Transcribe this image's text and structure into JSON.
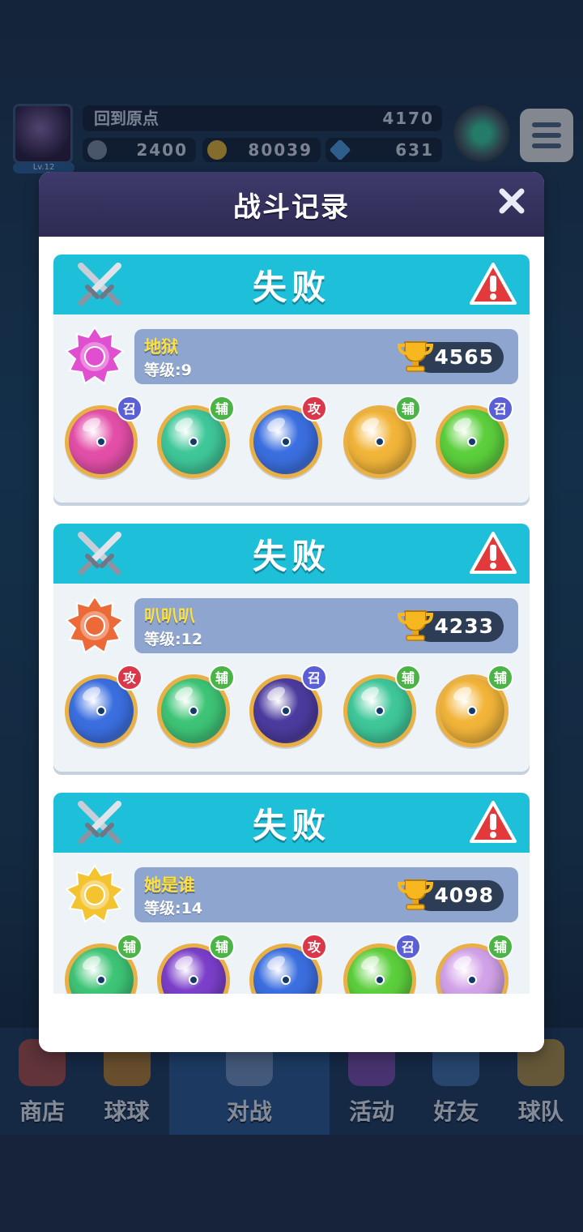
{
  "topbar": {
    "player_name": "回到原点",
    "trophies": "4170",
    "currency_a": "2400",
    "gold": "80039",
    "gems": "631",
    "level": "Lv.12"
  },
  "bottom_nav": [
    {
      "label": "商店",
      "icon": "shop-icon"
    },
    {
      "label": "球球",
      "icon": "ball-icon"
    },
    {
      "label": "对战",
      "icon": "battle-icon",
      "active": true
    },
    {
      "label": "活动",
      "icon": "event-icon"
    },
    {
      "label": "好友",
      "icon": "friends-icon"
    },
    {
      "label": "球队",
      "icon": "team-icon"
    }
  ],
  "modal": {
    "title": "战斗记录",
    "close_icon": "close-icon"
  },
  "records": [
    {
      "result": "失败",
      "opponent": "地狱",
      "level": "等级:9",
      "trophies": "4565",
      "medal_color": "#e04fd0",
      "balls": [
        {
          "role": "召",
          "color": "#e34fa8",
          "icon": "blade-ball-icon"
        },
        {
          "role": "辅",
          "color": "#3fc79a",
          "icon": "sp-ball-icon"
        },
        {
          "role": "攻",
          "color": "#3b6fe0",
          "icon": "vortex-ball-icon"
        },
        {
          "role": "辅",
          "color": "#f2b53a",
          "icon": "skull-ball-icon"
        },
        {
          "role": "召",
          "color": "#5ccf3d",
          "icon": "star-ball-icon"
        }
      ]
    },
    {
      "result": "失败",
      "opponent": "叭叭叭",
      "level": "等级:12",
      "trophies": "4233",
      "medal_color": "#ec6a37",
      "balls": [
        {
          "role": "攻",
          "color": "#3b6fe0",
          "icon": "vortex-ball-icon"
        },
        {
          "role": "辅",
          "color": "#3ec476",
          "icon": "arrow-ball-icon"
        },
        {
          "role": "召",
          "color": "#4c3b9e",
          "icon": "ghost-ball-icon"
        },
        {
          "role": "辅",
          "color": "#3fc79a",
          "icon": "sp-ball-icon"
        },
        {
          "role": "辅",
          "color": "#f2b53a",
          "icon": "skull-ball-icon"
        }
      ]
    },
    {
      "result": "失败",
      "opponent": "她是谁",
      "level": "等级:14",
      "trophies": "4098",
      "medal_color": "#f4c430",
      "balls": [
        {
          "role": "辅",
          "color": "#3ec476",
          "icon": "arrow-ball-icon"
        },
        {
          "role": "辅",
          "color": "#7b3fc9",
          "icon": "wing-ball-icon"
        },
        {
          "role": "攻",
          "color": "#3b6fe0",
          "icon": "vortex-ball-icon"
        },
        {
          "role": "召",
          "color": "#5ccf3d",
          "icon": "star-ball-icon"
        },
        {
          "role": "辅",
          "color": "#d2a2e8",
          "icon": "octopus-ball-icon"
        }
      ]
    }
  ]
}
